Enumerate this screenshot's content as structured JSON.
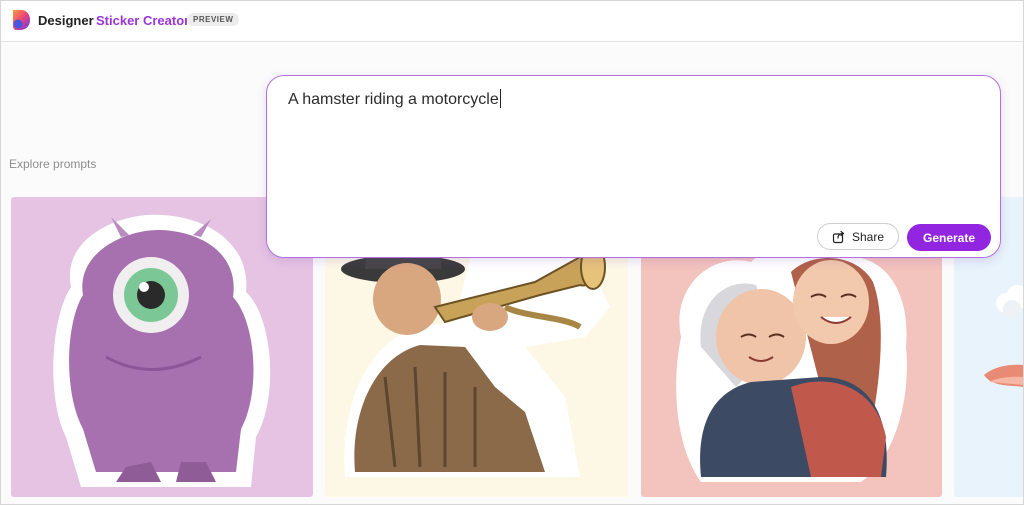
{
  "header": {
    "brand": "Designer",
    "product": "Sticker Creator",
    "badge": "PREVIEW"
  },
  "prompt": {
    "value": "A hamster riding a motorcycle",
    "share_label": "Share",
    "generate_label": "Generate"
  },
  "explore": {
    "label": "Explore prompts",
    "cards": [
      {
        "image": "purple-one-eyed-monster-sticker",
        "background": "#e6c3e3"
      },
      {
        "image": "trumpet-player-sticker",
        "background": "#fdf8e6"
      },
      {
        "image": "grandmother-granddaughter-hug-sticker",
        "background": "#f3c3bd"
      },
      {
        "image": "clouds-sticker",
        "background": "#e8f3fb"
      }
    ]
  },
  "colors": {
    "accent": "#9a35d8",
    "generate_button": "#9225e0",
    "prompt_border": "#b071e0"
  }
}
